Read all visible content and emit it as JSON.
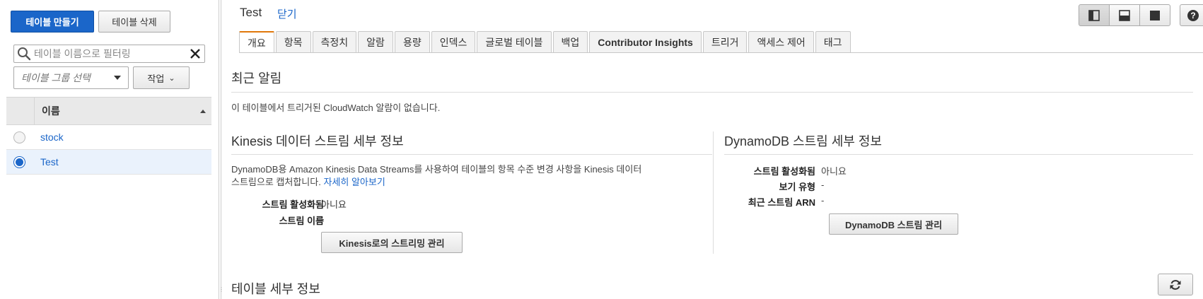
{
  "left": {
    "create_button": "테이블 만들기",
    "delete_button": "테이블 삭제",
    "filter_placeholder": "테이블 이름으로 필터링",
    "group_placeholder": "테이블 그룹 선택",
    "action_button": "작업",
    "column_name": "이름",
    "rows": [
      {
        "name": "stock",
        "selected": false
      },
      {
        "name": "Test",
        "selected": true
      }
    ]
  },
  "header": {
    "title": "Test",
    "close_link": "닫기"
  },
  "tabs": [
    {
      "label": "개요",
      "active": true
    },
    {
      "label": "항목"
    },
    {
      "label": "측정치"
    },
    {
      "label": "알람"
    },
    {
      "label": "용량"
    },
    {
      "label": "인덱스"
    },
    {
      "label": "글로벌 테이블"
    },
    {
      "label": "백업"
    },
    {
      "label": "Contributor Insights"
    },
    {
      "label": "트리거"
    },
    {
      "label": "액세스 제어"
    },
    {
      "label": "태그"
    }
  ],
  "alarms": {
    "heading": "최근 알림",
    "message": "이 테이블에서 트리거된 CloudWatch 알람이 없습니다."
  },
  "kinesis": {
    "heading": "Kinesis 데이터 스트림 세부 정보",
    "description_line1": "DynamoDB용 Amazon Kinesis Data Streams를 사용하여 테이블의 항목 수준 변경 사항을 Kinesis 데이터",
    "description_line2": "스트림으로 캡처합니다.",
    "learn_more": "자세히 알아보기",
    "enabled_label": "스트림 활성화됨",
    "enabled_value": "아니요",
    "stream_name_label": "스트림 이름",
    "stream_name_value": "-",
    "manage_button": "Kinesis로의 스트리밍 관리"
  },
  "dynamodb_stream": {
    "heading": "DynamoDB 스트림 세부 정보",
    "enabled_label": "스트림 활성화됨",
    "enabled_value": "아니요",
    "view_type_label": "보기 유형",
    "view_type_value": "-",
    "latest_arn_label": "최근 스트림 ARN",
    "latest_arn_value": "-",
    "manage_button": "DynamoDB 스트림 관리"
  },
  "table_details": {
    "heading": "테이블 세부 정보"
  },
  "icons": {
    "search": "search-icon",
    "clear": "close-icon",
    "refresh": "refresh-icon",
    "help": "help-icon"
  },
  "colors": {
    "primary": "#1b66c9",
    "tab_accent": "#e0780b"
  }
}
